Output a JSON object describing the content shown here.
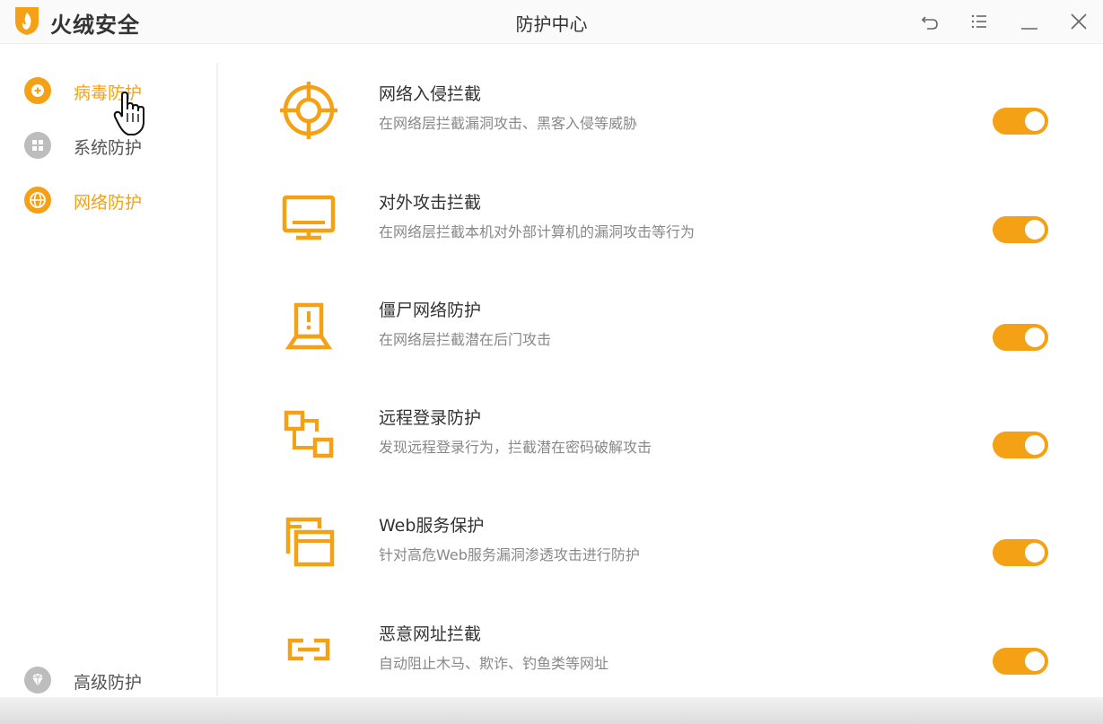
{
  "app": {
    "name": "火绒安全",
    "window_title": "防护中心"
  },
  "window_controls": [
    "back-icon",
    "menu-icon",
    "minimize-icon",
    "close-icon"
  ],
  "sidebar": {
    "items": [
      {
        "label": "病毒防护",
        "icon": "plus-circle-icon",
        "active": true
      },
      {
        "label": "系统防护",
        "icon": "windows-icon",
        "active": false
      },
      {
        "label": "网络防护",
        "icon": "globe-icon",
        "active": true
      }
    ],
    "bottom_item": {
      "label": "高级防护",
      "icon": "diamond-icon"
    }
  },
  "features": [
    {
      "title": "网络入侵拦截",
      "desc": "在网络层拦截漏洞攻击、黑客入侵等威胁",
      "icon": "crosshair-icon",
      "enabled": true
    },
    {
      "title": "对外攻击拦截",
      "desc": "在网络层拦截本机对外部计算机的漏洞攻击等行为",
      "icon": "monitor-icon",
      "enabled": true
    },
    {
      "title": "僵尸网络防护",
      "desc": "在网络层拦截潜在后门攻击",
      "icon": "laptop-alert-icon",
      "enabled": true
    },
    {
      "title": "远程登录防护",
      "desc": "发现远程登录行为，拦截潜在密码破解攻击",
      "icon": "remote-connect-icon",
      "enabled": true
    },
    {
      "title": "Web服务保护",
      "desc": "针对高危Web服务漏洞渗透攻击进行防护",
      "icon": "windows-stack-icon",
      "enabled": true
    },
    {
      "title": "恶意网址拦截",
      "desc": "自动阻止木马、欺诈、钓鱼类等网址",
      "icon": "link-icon",
      "enabled": true
    }
  ],
  "colors": {
    "accent": "#f5a115",
    "text": "#333333",
    "muted": "#888888",
    "inactive_icon": "#bdbdbd"
  }
}
